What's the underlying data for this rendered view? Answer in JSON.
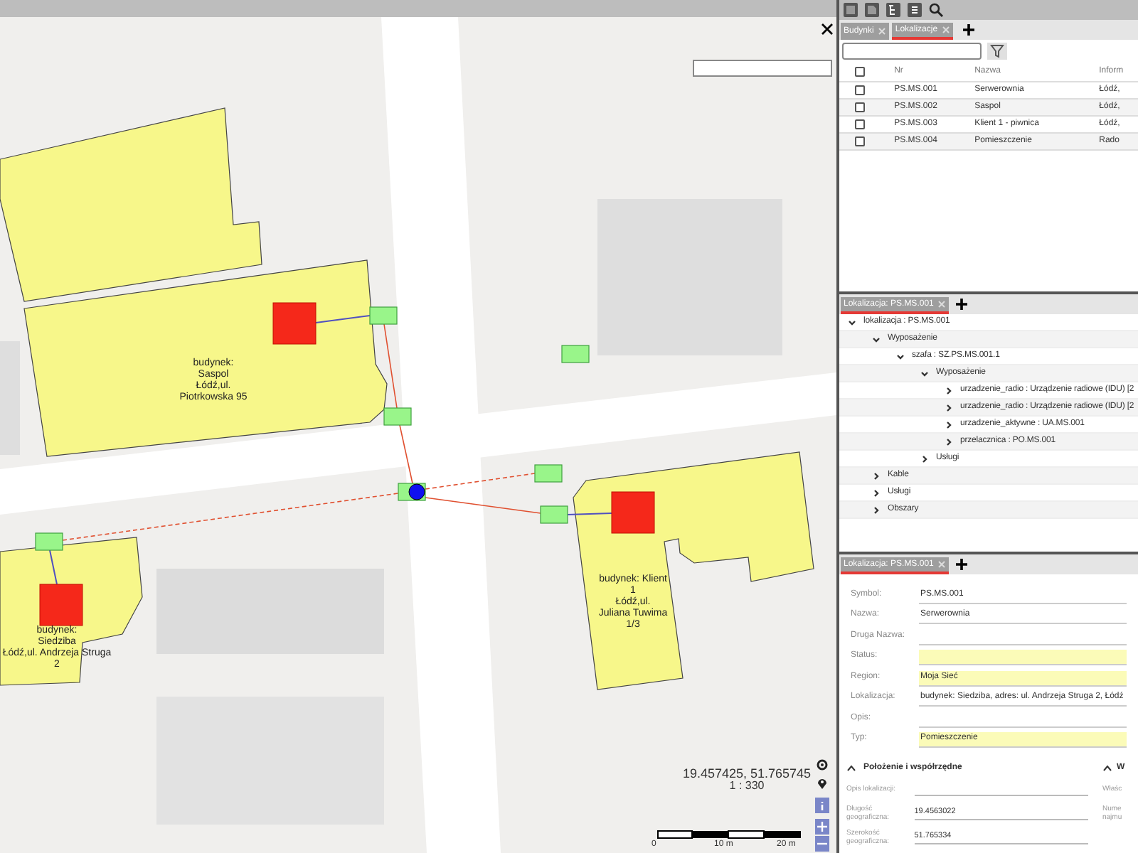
{
  "map": {
    "buildings": [
      {
        "label": "budynek:\nSaspol\nŁódź,ul.\nPiotrkowska 95"
      },
      {
        "label": "budynek:\nSiedziba\nŁódź,ul.  Andrzeja Struga 2"
      },
      {
        "label": "budynek: Klient\n1\nŁódź,ul.\nJuliana Tuwima\n1/3"
      }
    ],
    "coordinates": "19.457425, 51.765745",
    "scale": "1 : 330",
    "scale_ticks": [
      "0",
      "10 m",
      "20 m"
    ]
  },
  "list_panel": {
    "tabs": [
      {
        "label": "Budynki",
        "selected": false
      },
      {
        "label": "Lokalizacje",
        "selected": true
      }
    ],
    "select_all_checked": false,
    "columns": [
      "Nr",
      "Nazwa",
      "Inform"
    ],
    "rows": [
      {
        "nr": "PS.MS.001",
        "nazwa": "Serwerownia",
        "info": "Łódź,",
        "checked": false
      },
      {
        "nr": "PS.MS.002",
        "nazwa": "Saspol",
        "info": "Łódź,",
        "checked": false
      },
      {
        "nr": "PS.MS.003",
        "nazwa": "Klient 1 - piwnica",
        "info": "Łódź,",
        "checked": false
      },
      {
        "nr": "PS.MS.004",
        "nazwa": "Pomieszczenie",
        "info": "Rado",
        "checked": false
      }
    ]
  },
  "tree_panel": {
    "tabs": [
      {
        "label": "Lokalizacja: PS.MS.001",
        "selected": true
      }
    ],
    "tree": [
      {
        "label": "lokalizacja : PS.MS.001",
        "expanded": true,
        "children": [
          {
            "label": "Wyposażenie",
            "expanded": true,
            "children": [
              {
                "label": "szafa : SZ.PS.MS.001.1",
                "expanded": true,
                "children": [
                  {
                    "label": "Wyposażenie",
                    "expanded": true,
                    "children": [
                      {
                        "label": "urzadzenie_radio : Urządzenie radiowe (IDU) [2",
                        "expanded": false
                      },
                      {
                        "label": "urzadzenie_radio : Urządzenie radiowe (IDU) [2",
                        "expanded": false
                      },
                      {
                        "label": "urzadzenie_aktywne : UA.MS.001",
                        "expanded": false
                      },
                      {
                        "label": "przelacznica : PO.MS.001",
                        "expanded": false
                      }
                    ]
                  },
                  {
                    "label": "Usługi",
                    "expanded": false
                  }
                ]
              }
            ]
          },
          {
            "label": "Kable",
            "expanded": false
          },
          {
            "label": "Usługi",
            "expanded": false
          },
          {
            "label": "Obszary",
            "expanded": false
          }
        ]
      }
    ]
  },
  "details_panel": {
    "tabs": [
      {
        "label": "Lokalizacja: PS.MS.001",
        "selected": true
      }
    ],
    "fields": [
      {
        "label": "Symbol:",
        "value": "PS.MS.001",
        "highlighted": false
      },
      {
        "label": "Nazwa:",
        "value": "Serwerownia",
        "highlighted": false
      },
      {
        "label": "Druga Nazwa:",
        "highlighted": false
      },
      {
        "label": "Status:",
        "highlighted": true
      },
      {
        "label": "Region:",
        "value": "Moja Sieć",
        "highlighted": true
      },
      {
        "label": "Lokalizacja:",
        "value": "budynek: Siedziba, adres: ul. Andrzeja Struga 2, Łódź",
        "highlighted": false
      },
      {
        "label": "Opis:",
        "highlighted": false
      },
      {
        "label": "Typ:",
        "value": "Pomieszczenie",
        "highlighted": true
      }
    ],
    "sections": [
      {
        "title": "Położenie i współrzędne",
        "expanded": true,
        "fields": [
          {
            "label": "Opis lokalizacji:"
          },
          {
            "label": "Długość geograficzna:",
            "value": "19.4563022"
          },
          {
            "label": "Szerokość geograficzna:",
            "value": "51.765334"
          }
        ]
      },
      {
        "title": "W",
        "expanded": true,
        "fields": [
          {
            "label": "Właśc"
          },
          {
            "label": "Nume najmu"
          }
        ]
      }
    ]
  }
}
